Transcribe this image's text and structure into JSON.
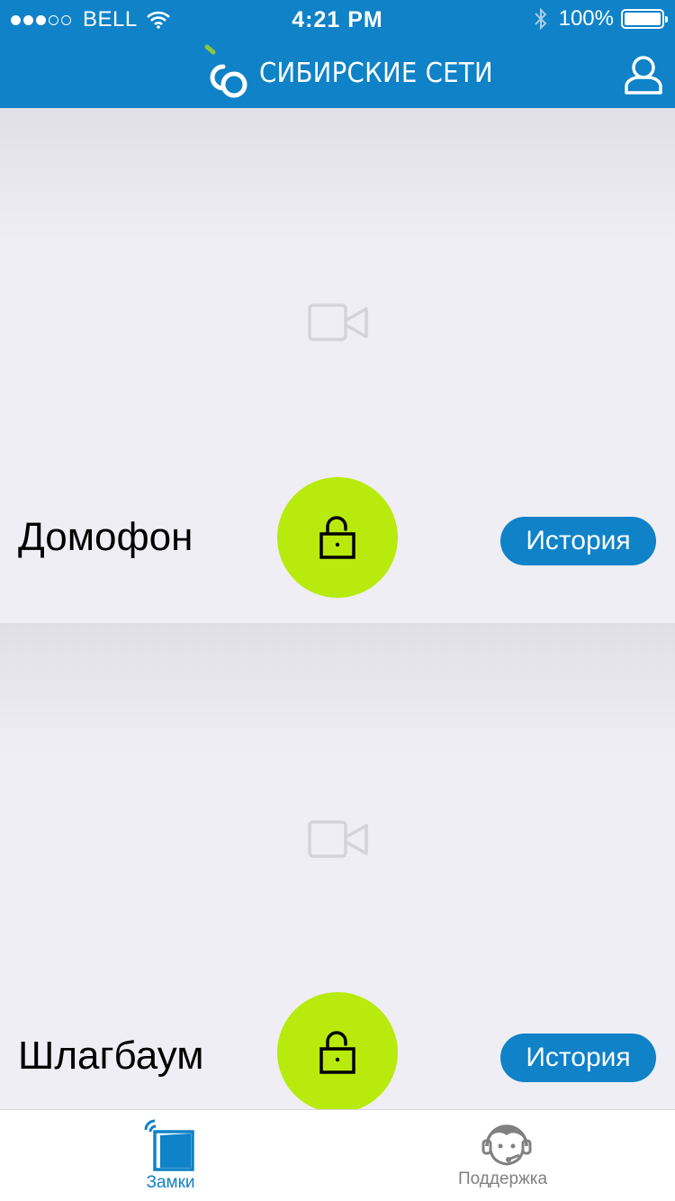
{
  "status_bar": {
    "carrier": "BELL",
    "time": "4:21 PM",
    "battery": "100%"
  },
  "header": {
    "brand_name": "СИБИРСКИЕ СЕТИ"
  },
  "locks": [
    {
      "title": "Домофон",
      "history_label": "История"
    },
    {
      "title": "Шлагбаум",
      "history_label": "История"
    }
  ],
  "tabs": [
    {
      "label": "Замки",
      "active": true
    },
    {
      "label": "Поддержка",
      "active": false
    }
  ],
  "colors": {
    "primary": "#0f82c8",
    "accent": "#b8ea0d",
    "background": "#efeef4"
  }
}
